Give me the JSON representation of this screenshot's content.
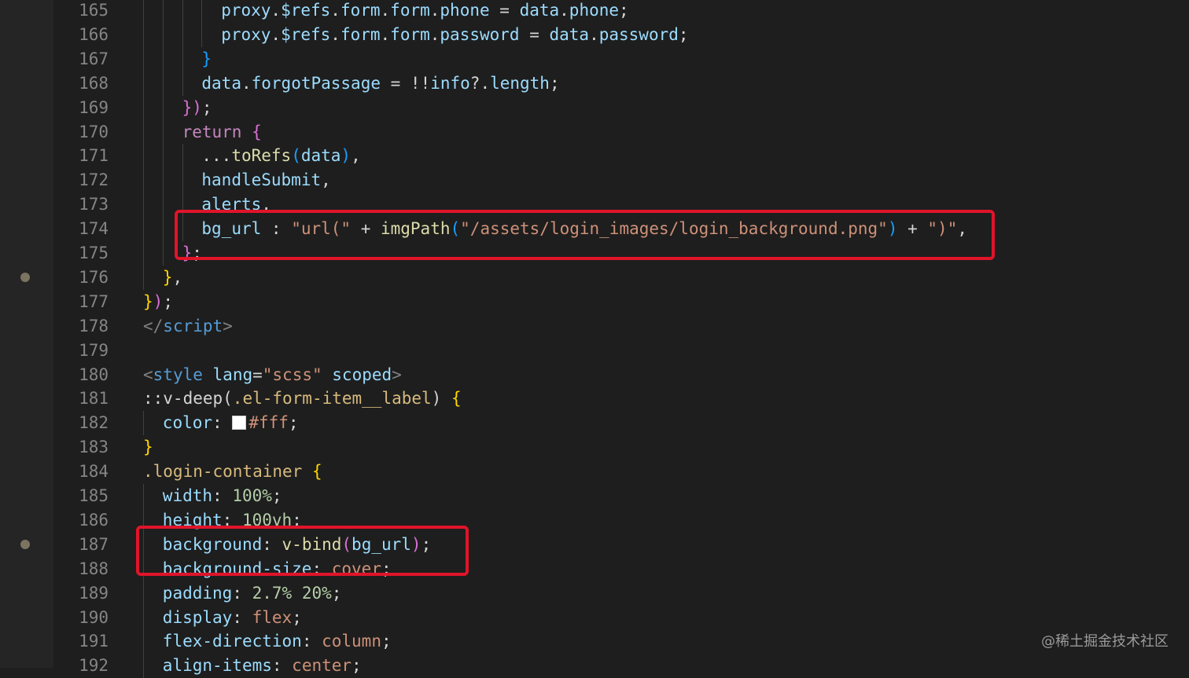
{
  "editor": {
    "lines": [
      {
        "num": "165",
        "indent": 4,
        "tokens": [
          {
            "c": "v",
            "t": "proxy"
          },
          {
            "c": "w",
            "t": "."
          },
          {
            "c": "v",
            "t": "$refs"
          },
          {
            "c": "w",
            "t": "."
          },
          {
            "c": "v",
            "t": "form"
          },
          {
            "c": "w",
            "t": "."
          },
          {
            "c": "v",
            "t": "form"
          },
          {
            "c": "w",
            "t": "."
          },
          {
            "c": "v",
            "t": "phone"
          },
          {
            "c": "w",
            "t": " = "
          },
          {
            "c": "v",
            "t": "data"
          },
          {
            "c": "w",
            "t": "."
          },
          {
            "c": "v",
            "t": "phone"
          },
          {
            "c": "w",
            "t": ";"
          }
        ]
      },
      {
        "num": "166",
        "indent": 4,
        "tokens": [
          {
            "c": "v",
            "t": "proxy"
          },
          {
            "c": "w",
            "t": "."
          },
          {
            "c": "v",
            "t": "$refs"
          },
          {
            "c": "w",
            "t": "."
          },
          {
            "c": "v",
            "t": "form"
          },
          {
            "c": "w",
            "t": "."
          },
          {
            "c": "v",
            "t": "form"
          },
          {
            "c": "w",
            "t": "."
          },
          {
            "c": "v",
            "t": "password"
          },
          {
            "c": "w",
            "t": " = "
          },
          {
            "c": "v",
            "t": "data"
          },
          {
            "c": "w",
            "t": "."
          },
          {
            "c": "v",
            "t": "password"
          },
          {
            "c": "w",
            "t": ";"
          }
        ]
      },
      {
        "num": "167",
        "indent": 3,
        "tokens": [
          {
            "c": "b",
            "t": "}"
          }
        ]
      },
      {
        "num": "168",
        "indent": 3,
        "tokens": [
          {
            "c": "v",
            "t": "data"
          },
          {
            "c": "w",
            "t": "."
          },
          {
            "c": "v",
            "t": "forgotPassage"
          },
          {
            "c": "w",
            "t": " = !!"
          },
          {
            "c": "v",
            "t": "info"
          },
          {
            "c": "w",
            "t": "?."
          },
          {
            "c": "v",
            "t": "length"
          },
          {
            "c": "w",
            "t": ";"
          }
        ]
      },
      {
        "num": "169",
        "indent": 2,
        "tokens": [
          {
            "c": "p",
            "t": "})"
          },
          {
            "c": "w",
            "t": ";"
          }
        ]
      },
      {
        "num": "170",
        "indent": 2,
        "tokens": [
          {
            "c": "k",
            "t": "return"
          },
          {
            "c": "w",
            "t": " "
          },
          {
            "c": "p",
            "t": "{"
          }
        ]
      },
      {
        "num": "171",
        "indent": 3,
        "tokens": [
          {
            "c": "w",
            "t": "..."
          },
          {
            "c": "f",
            "t": "toRefs"
          },
          {
            "c": "b",
            "t": "("
          },
          {
            "c": "v",
            "t": "data"
          },
          {
            "c": "b",
            "t": ")"
          },
          {
            "c": "w",
            "t": ","
          }
        ]
      },
      {
        "num": "172",
        "indent": 3,
        "tokens": [
          {
            "c": "v",
            "t": "handleSubmit"
          },
          {
            "c": "w",
            "t": ","
          }
        ]
      },
      {
        "num": "173",
        "indent": 3,
        "tokens": [
          {
            "c": "v",
            "t": "alerts"
          },
          {
            "c": "w",
            "t": ","
          }
        ]
      },
      {
        "num": "174",
        "indent": 3,
        "tokens": [
          {
            "c": "v",
            "t": "bg_url"
          },
          {
            "c": "w",
            "t": " : "
          },
          {
            "c": "s",
            "t": "\"url(\""
          },
          {
            "c": "w",
            "t": " + "
          },
          {
            "c": "f",
            "t": "imgPath"
          },
          {
            "c": "b",
            "t": "("
          },
          {
            "c": "s",
            "t": "\"/assets/login_images/login_background.png\""
          },
          {
            "c": "b",
            "t": ")"
          },
          {
            "c": "w",
            "t": " + "
          },
          {
            "c": "s",
            "t": "\")\""
          },
          {
            "c": "w",
            "t": ","
          }
        ]
      },
      {
        "num": "175",
        "indent": 2,
        "tokens": [
          {
            "c": "p",
            "t": "}"
          },
          {
            "c": "w",
            "t": ";"
          }
        ]
      },
      {
        "num": "176",
        "indent": 1,
        "tokens": [
          {
            "c": "y",
            "t": "}"
          },
          {
            "c": "w",
            "t": ","
          }
        ]
      },
      {
        "num": "177",
        "indent": 0,
        "tokens": [
          {
            "c": "y",
            "t": "}"
          },
          {
            "c": "p",
            "t": ")"
          },
          {
            "c": "w",
            "t": ";"
          }
        ]
      },
      {
        "num": "178",
        "indent": 0,
        "tokens": [
          {
            "c": "g",
            "t": "</"
          },
          {
            "c": "t",
            "t": "script"
          },
          {
            "c": "g",
            "t": ">"
          }
        ]
      },
      {
        "num": "179",
        "indent": 0,
        "tokens": []
      },
      {
        "num": "180",
        "indent": 0,
        "tokens": [
          {
            "c": "g",
            "t": "<"
          },
          {
            "c": "t",
            "t": "style"
          },
          {
            "c": "w",
            "t": " "
          },
          {
            "c": "v",
            "t": "lang"
          },
          {
            "c": "w",
            "t": "="
          },
          {
            "c": "s",
            "t": "\"scss\""
          },
          {
            "c": "w",
            "t": " "
          },
          {
            "c": "v",
            "t": "scoped"
          },
          {
            "c": "g",
            "t": ">"
          }
        ]
      },
      {
        "num": "181",
        "indent": 0,
        "tokens": [
          {
            "c": "w",
            "t": "::v-deep("
          },
          {
            "c": "c",
            "t": ".el-form-item__label"
          },
          {
            "c": "w",
            "t": ") "
          },
          {
            "c": "y",
            "t": "{"
          }
        ]
      },
      {
        "num": "182",
        "indent": 1,
        "tokens": [
          {
            "c": "v",
            "t": "color"
          },
          {
            "c": "w",
            "t": ": "
          },
          {
            "c": "swatch",
            "t": ""
          },
          {
            "c": "s",
            "t": "#fff"
          },
          {
            "c": "w",
            "t": ";"
          }
        ]
      },
      {
        "num": "183",
        "indent": 0,
        "tokens": [
          {
            "c": "y",
            "t": "}"
          }
        ]
      },
      {
        "num": "184",
        "indent": 0,
        "tokens": [
          {
            "c": "c",
            "t": ".login-container"
          },
          {
            "c": "w",
            "t": " "
          },
          {
            "c": "y",
            "t": "{"
          }
        ]
      },
      {
        "num": "185",
        "indent": 1,
        "tokens": [
          {
            "c": "v",
            "t": "width"
          },
          {
            "c": "w",
            "t": ": "
          },
          {
            "c": "n",
            "t": "100%"
          },
          {
            "c": "w",
            "t": ";"
          }
        ]
      },
      {
        "num": "186",
        "indent": 1,
        "tokens": [
          {
            "c": "v",
            "t": "height"
          },
          {
            "c": "w",
            "t": ": "
          },
          {
            "c": "n",
            "t": "100vh"
          },
          {
            "c": "w",
            "t": ";"
          }
        ]
      },
      {
        "num": "187",
        "indent": 1,
        "tokens": [
          {
            "c": "v",
            "t": "background"
          },
          {
            "c": "w",
            "t": ": "
          },
          {
            "c": "f",
            "t": "v-bind"
          },
          {
            "c": "p",
            "t": "("
          },
          {
            "c": "v",
            "t": "bg_url"
          },
          {
            "c": "p",
            "t": ")"
          },
          {
            "c": "w",
            "t": ";"
          }
        ]
      },
      {
        "num": "188",
        "indent": 1,
        "tokens": [
          {
            "c": "v",
            "t": "background-size"
          },
          {
            "c": "w",
            "t": ": "
          },
          {
            "c": "s",
            "t": "cover"
          },
          {
            "c": "w",
            "t": ";"
          }
        ]
      },
      {
        "num": "189",
        "indent": 1,
        "tokens": [
          {
            "c": "v",
            "t": "padding"
          },
          {
            "c": "w",
            "t": ": "
          },
          {
            "c": "n",
            "t": "2.7%"
          },
          {
            "c": "w",
            "t": " "
          },
          {
            "c": "n",
            "t": "20%"
          },
          {
            "c": "w",
            "t": ";"
          }
        ]
      },
      {
        "num": "190",
        "indent": 1,
        "tokens": [
          {
            "c": "v",
            "t": "display"
          },
          {
            "c": "w",
            "t": ": "
          },
          {
            "c": "s",
            "t": "flex"
          },
          {
            "c": "w",
            "t": ";"
          }
        ]
      },
      {
        "num": "191",
        "indent": 1,
        "tokens": [
          {
            "c": "v",
            "t": "flex-direction"
          },
          {
            "c": "w",
            "t": ": "
          },
          {
            "c": "s",
            "t": "column"
          },
          {
            "c": "w",
            "t": ";"
          }
        ]
      },
      {
        "num": "192",
        "indent": 1,
        "tokens": [
          {
            "c": "v",
            "t": "align-items"
          },
          {
            "c": "w",
            "t": ": "
          },
          {
            "c": "s",
            "t": "center"
          },
          {
            "c": "w",
            "t": ";"
          }
        ]
      }
    ],
    "breakpoint_lines": [
      "176",
      "187"
    ],
    "highlight_lines": [
      "174",
      "187"
    ]
  },
  "watermark": "@稀土掘金技术社区",
  "colors": {
    "background": "#1e1e1e",
    "highlight_box": "#e0142a"
  }
}
